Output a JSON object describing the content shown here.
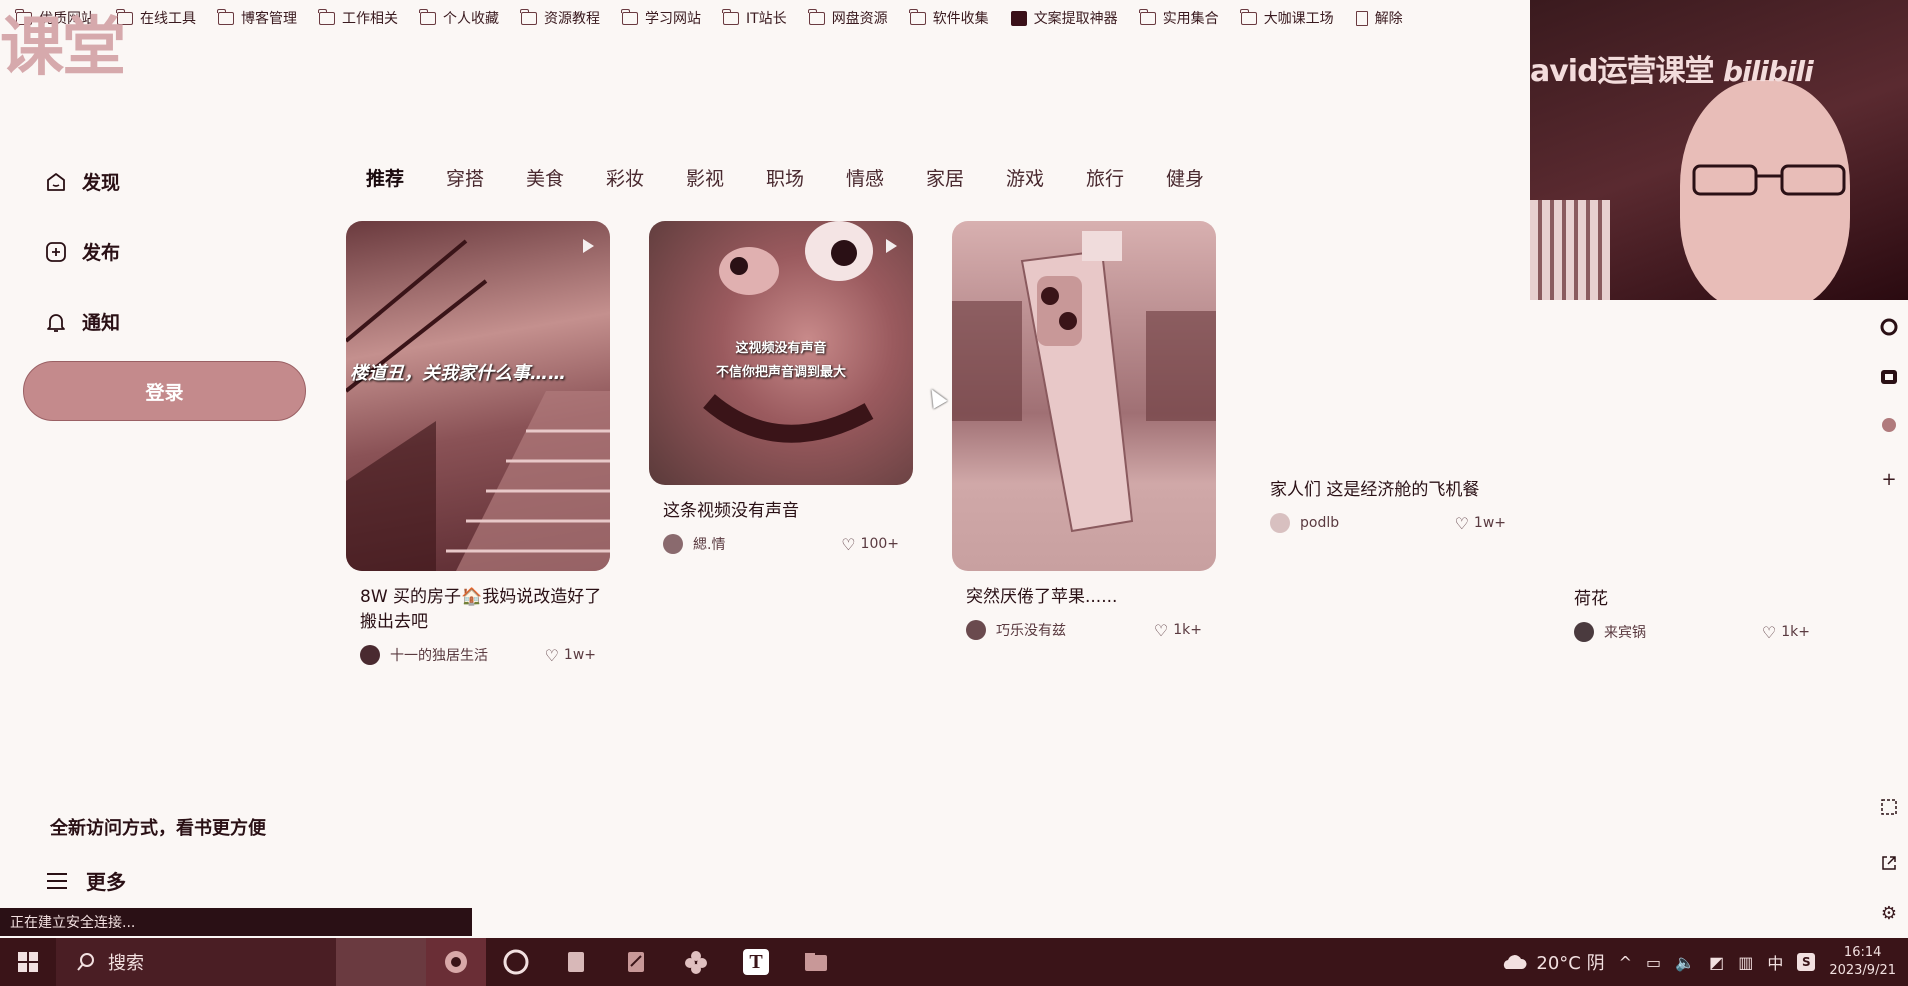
{
  "bookmarks": [
    {
      "label": "优质网站",
      "icon": "folder-icon"
    },
    {
      "label": "在线工具",
      "icon": "folder-icon"
    },
    {
      "label": "博客管理",
      "icon": "folder-icon"
    },
    {
      "label": "工作相关",
      "icon": "folder-icon"
    },
    {
      "label": "个人收藏",
      "icon": "folder-icon"
    },
    {
      "label": "资源教程",
      "icon": "folder-icon"
    },
    {
      "label": "学习网站",
      "icon": "folder-icon"
    },
    {
      "label": "IT站长",
      "icon": "folder-icon"
    },
    {
      "label": "网盘资源",
      "icon": "folder-icon"
    },
    {
      "label": "软件收集",
      "icon": "folder-icon"
    },
    {
      "label": "文案提取神器",
      "icon": "app-icon"
    },
    {
      "label": "实用集合",
      "icon": "folder-icon"
    },
    {
      "label": "大咖课工场",
      "icon": "folder-icon"
    },
    {
      "label": "解除",
      "icon": "doc-icon"
    }
  ],
  "watermark": "课堂",
  "sidebar": {
    "items": [
      {
        "label": "发现",
        "icon": "home-icon"
      },
      {
        "label": "发布",
        "icon": "plus-square-icon"
      },
      {
        "label": "通知",
        "icon": "bell-icon"
      }
    ],
    "login": "登录",
    "promo": "全新访问方式，看书更方便",
    "more": "更多"
  },
  "tabs": [
    "推荐",
    "穿搭",
    "美食",
    "彩妆",
    "影视",
    "职场",
    "情感",
    "家居",
    "游戏",
    "旅行",
    "健身"
  ],
  "cards": [
    {
      "title": "8W 买的房子🏠我妈说改造好了搬出去吧",
      "author": "十一的独居生活",
      "likes": "1w+",
      "overlay": "楼道丑，关我家什么事……"
    },
    {
      "title": "这条视频没有声音",
      "author": "緦.情",
      "likes": "100+",
      "overlay_line1": "这视频没有声音",
      "overlay_line2": "不信你把声音调到最大"
    },
    {
      "title": "突然厌倦了苹果......",
      "author": "巧乐没有兹",
      "likes": "1k+"
    },
    {
      "title": "家人们 这是经济舱的飞机餐",
      "author": "podlb",
      "likes": "1w+"
    },
    {
      "title": "荷花",
      "author": "来宾锅",
      "likes": "1k+"
    }
  ],
  "webcam": {
    "title": "avid运营课堂",
    "logo": "bilibili"
  },
  "status": "正在建立安全连接...",
  "taskbar": {
    "search": "搜索",
    "weather": "20°C 阴",
    "ime": "中",
    "time": "16:14",
    "date": "2023/9/21"
  }
}
